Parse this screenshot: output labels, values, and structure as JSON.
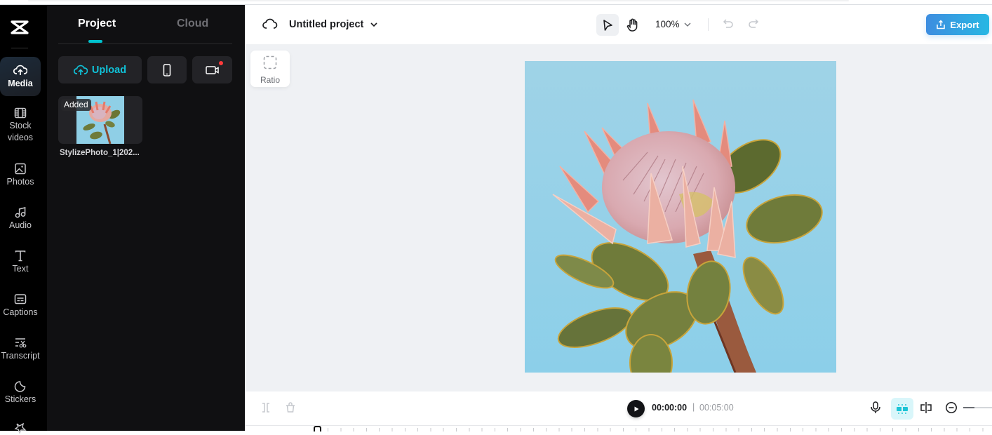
{
  "nav": {
    "items": [
      {
        "label": "Media",
        "icon": "cloud-upload-icon",
        "active": true
      },
      {
        "label": "Stock videos",
        "icon": "film-icon"
      },
      {
        "label": "Photos",
        "icon": "image-icon"
      },
      {
        "label": "Audio",
        "icon": "music-note-icon"
      },
      {
        "label": "Text",
        "icon": "text-icon"
      },
      {
        "label": "Captions",
        "icon": "captions-icon"
      },
      {
        "label": "Transcript",
        "icon": "transcript-icon"
      },
      {
        "label": "Stickers",
        "icon": "sticker-icon"
      }
    ],
    "stock_line1": "Stock",
    "stock_line2": "videos"
  },
  "panel": {
    "tabs": [
      "Project",
      "Cloud"
    ],
    "active_tab": "Project",
    "upload_label": "Upload",
    "phone_button_icon": "phone-icon",
    "record_button_icon": "video-record-icon",
    "media": [
      {
        "name": "StylizePhoto_1|202...",
        "badge": "Added"
      }
    ]
  },
  "header": {
    "project_title": "Untitled project",
    "zoom_level": "100%",
    "export_label": "Export"
  },
  "canvas": {
    "ratio_label": "Ratio",
    "preview_subject": "protea flower on light blue background"
  },
  "playback": {
    "current_time": "00:00:00",
    "separator": "|",
    "total_time": "00:05:00",
    "timeline_zoom": 0.4
  },
  "colors": {
    "accent": "#00c1cd",
    "export_gradient_start": "#3d8de0",
    "export_gradient_end": "#27b7e3",
    "record_dot": "#ff3b3b"
  }
}
